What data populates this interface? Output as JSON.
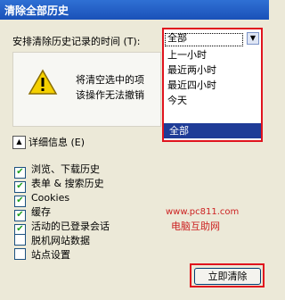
{
  "window": {
    "title": "清除全部历史"
  },
  "time_range": {
    "label": "安排清除历史记录的时间 (T):",
    "selected": "全部",
    "options": [
      "上一小时",
      "最近两小时",
      "最近四小时",
      "今天",
      "全部"
    ],
    "highlighted": "全部"
  },
  "warning": {
    "line1": "将清空选中的项",
    "line2": "该操作无法撤销"
  },
  "details": {
    "label": "详细信息 (E)"
  },
  "checkboxes": [
    {
      "label": "浏览、下载历史",
      "checked": true
    },
    {
      "label": "表单 & 搜索历史",
      "checked": true
    },
    {
      "label": "Cookies",
      "checked": true
    },
    {
      "label": "缓存",
      "checked": true
    },
    {
      "label": "活动的已登录会话",
      "checked": true
    },
    {
      "label": "脱机网站数据",
      "checked": false
    },
    {
      "label": "站点设置",
      "checked": false
    }
  ],
  "watermark": {
    "url": "www.pc811.com",
    "name": "电脑互助网"
  },
  "actions": {
    "clear_now": "立即清除"
  }
}
